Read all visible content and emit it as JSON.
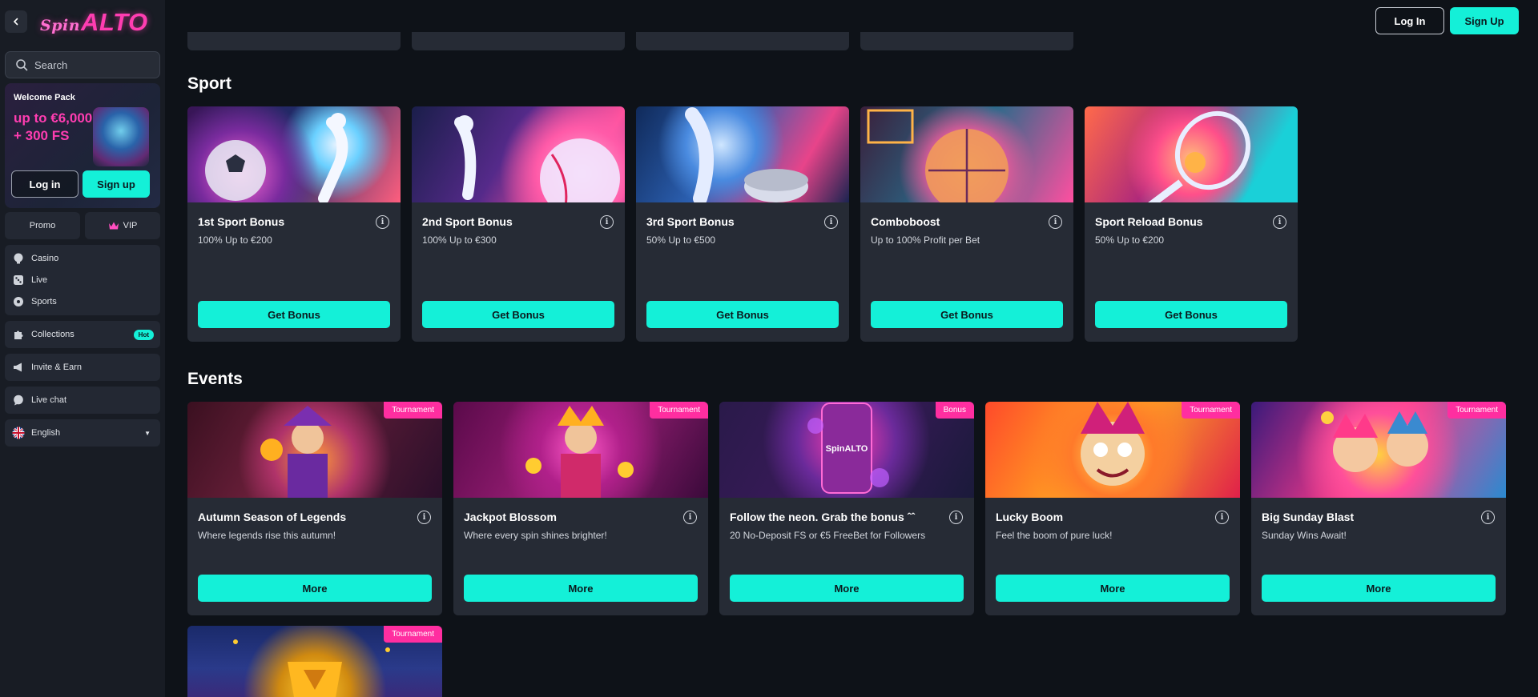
{
  "sidebar": {
    "logo_prefix": "Spin",
    "logo_main": "ALTO",
    "search_placeholder": "Search",
    "welcome": {
      "title": "Welcome Pack",
      "amount_line1": "up to €6,000",
      "amount_line2": "+ 300 FS",
      "login_label": "Log in",
      "signup_label": "Sign up"
    },
    "promo_label": "Promo",
    "vip_label": "VIP",
    "nav": [
      {
        "label": "Casino",
        "icon": "casino-icon"
      },
      {
        "label": "Live",
        "icon": "dice-icon"
      },
      {
        "label": "Sports",
        "icon": "ball-icon"
      }
    ],
    "collections_label": "Collections",
    "hot_badge": "Hot",
    "invite_label": "Invite & Earn",
    "livechat_label": "Live chat",
    "language_label": "English"
  },
  "header": {
    "login_label": "Log In",
    "signup_label": "Sign Up"
  },
  "sport": {
    "title": "Sport",
    "cards": [
      {
        "title": "1st Sport Bonus",
        "subtitle": "100% Up to €200",
        "button": "Get Bonus"
      },
      {
        "title": "2nd Sport Bonus",
        "subtitle": "100% Up to €300",
        "button": "Get Bonus"
      },
      {
        "title": "3rd Sport Bonus",
        "subtitle": "50% Up to €500",
        "button": "Get Bonus"
      },
      {
        "title": "Comboboost",
        "subtitle": "Up to 100% Profit per Bet",
        "button": "Get Bonus"
      },
      {
        "title": "Sport Reload Bonus",
        "subtitle": "50% Up to €200",
        "button": "Get Bonus"
      }
    ]
  },
  "events": {
    "title": "Events",
    "cards": [
      {
        "title": "Autumn Season of Legends",
        "subtitle": "Where legends rise this autumn!",
        "button": "More",
        "tag": "Tournament"
      },
      {
        "title": "Jackpot Blossom",
        "subtitle": "Where every spin shines brighter!",
        "button": "More",
        "tag": "Tournament"
      },
      {
        "title": "Follow the neon. Grab the bonus ˆˆ",
        "subtitle": "20 No-Deposit FS or €5 FreeBet for Followers",
        "button": "More",
        "tag": "Bonus"
      },
      {
        "title": "Lucky Boom",
        "subtitle": "Feel the boom of pure luck!",
        "button": "More",
        "tag": "Tournament"
      },
      {
        "title": "Big Sunday Blast",
        "subtitle": "Sunday Wins Await!",
        "button": "More",
        "tag": "Tournament"
      }
    ],
    "extra_tag": "Tournament"
  },
  "colors": {
    "accent": "#14f0d8",
    "brand_pink": "#ff3db1",
    "tag_pink": "#ff2ea0",
    "card_bg": "#262b35",
    "page_bg": "#0e1218"
  }
}
